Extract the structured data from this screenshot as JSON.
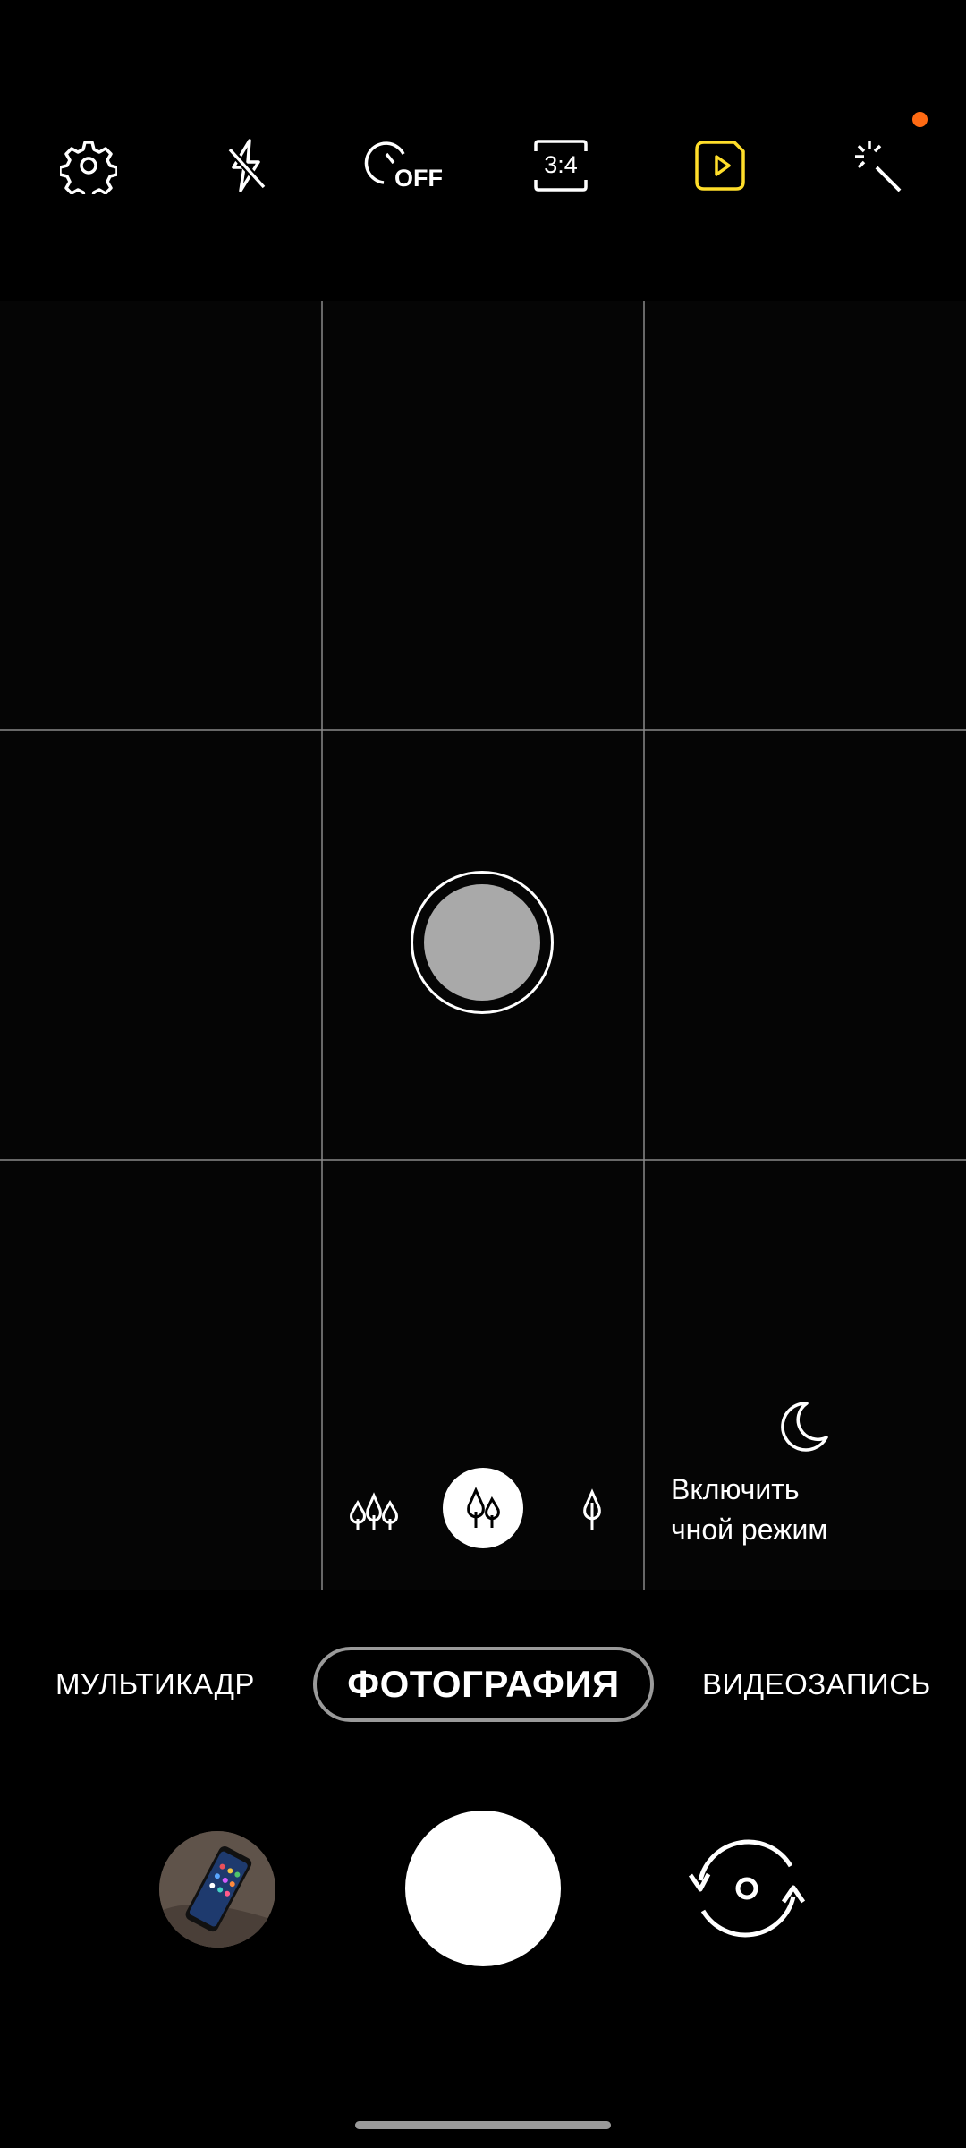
{
  "toolbar": {
    "items": [
      {
        "icon": "gear-icon"
      },
      {
        "icon": "flash-off-icon"
      },
      {
        "icon": "timer-off-icon",
        "label": "OFF"
      },
      {
        "icon": "aspect-ratio-icon",
        "label": "3:4"
      },
      {
        "icon": "motion-photo-icon"
      },
      {
        "icon": "filters-icon"
      }
    ],
    "accent_color": "#ffde2a",
    "notification_dot_color": "#ff6a13"
  },
  "viewfinder": {
    "lens_options": [
      {
        "icon": "ultra-wide-lens-icon",
        "selected": false
      },
      {
        "icon": "wide-lens-icon",
        "selected": true
      },
      {
        "icon": "telephoto-lens-icon",
        "selected": false
      }
    ],
    "night_mode": {
      "icon": "moon-icon",
      "label": "Включить\nчной режим"
    }
  },
  "modes": [
    {
      "label": "МУЛЬТИКАДР",
      "selected": false
    },
    {
      "label": "ФОТОГРАФИЯ",
      "selected": true
    },
    {
      "label": "ВИДЕОЗАПИСЬ",
      "selected": false
    }
  ],
  "controls": {
    "gallery_icon": "gallery-thumbnail",
    "shutter_icon": "shutter-button",
    "switch_icon": "switch-camera-icon"
  }
}
